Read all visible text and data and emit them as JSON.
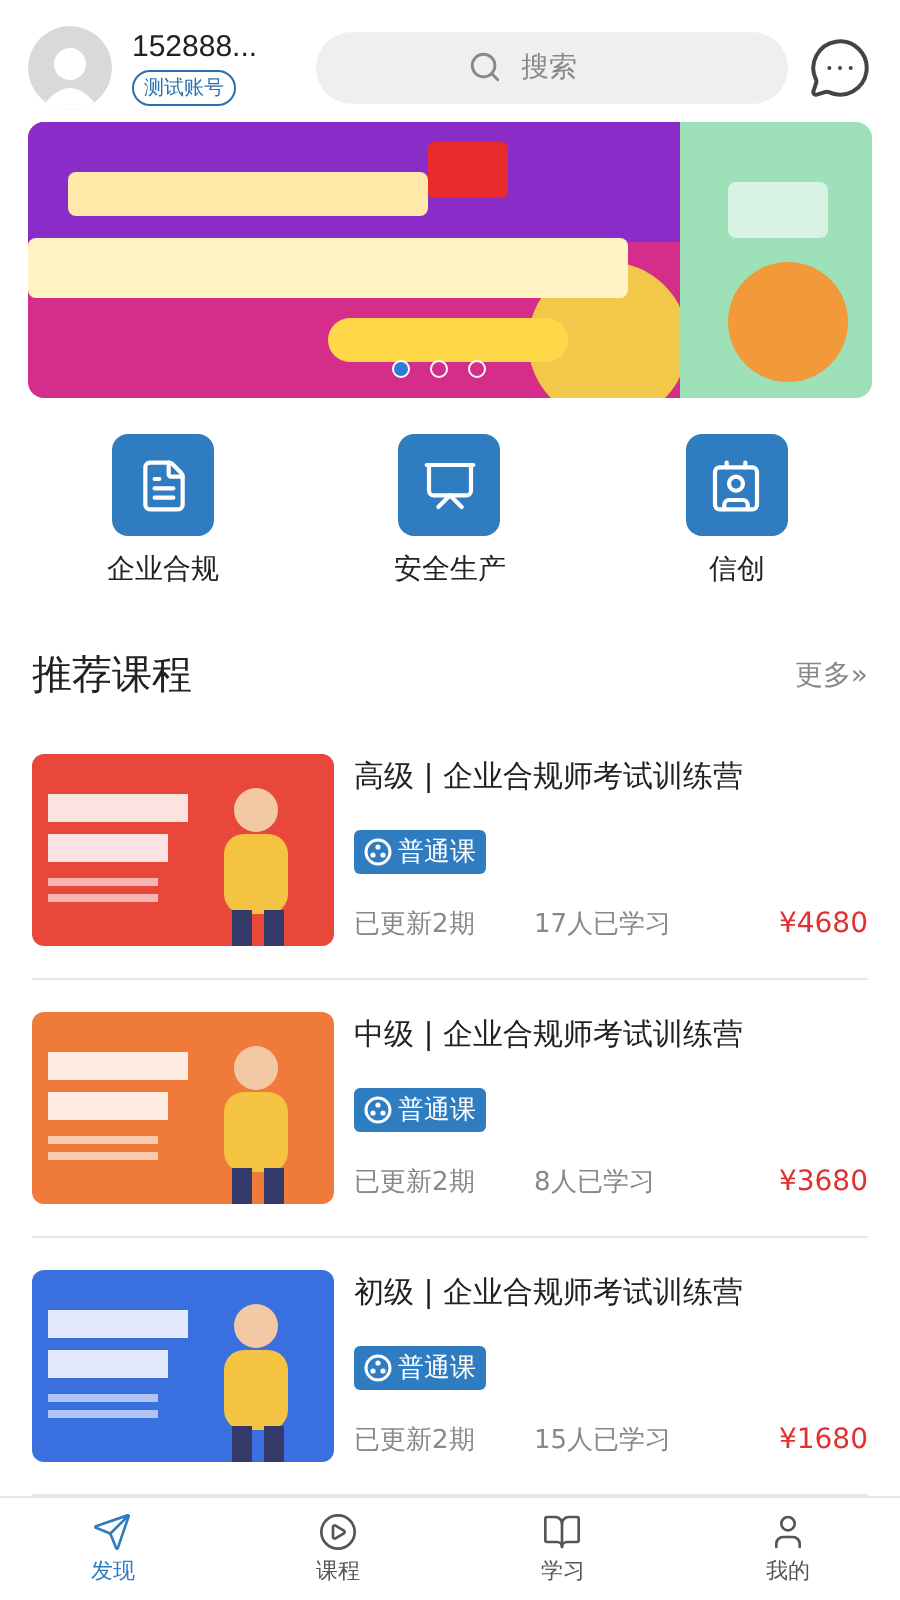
{
  "header": {
    "username": "152888...",
    "badge": "测试账号",
    "search": {
      "placeholder": "搜索"
    }
  },
  "banner": {
    "dots": [
      {
        "selected": true
      },
      {
        "selected": false
      },
      {
        "selected": false
      }
    ]
  },
  "categories": [
    {
      "label": "企业合规"
    },
    {
      "label": "安全生产"
    },
    {
      "label": "信创"
    }
  ],
  "section": {
    "title": "推荐课程",
    "more": "更多»"
  },
  "courses": [
    {
      "title": "高级 | 企业合规师考试训练营",
      "tag": "普通课",
      "updated": "已更新2期",
      "learners": "17人已学习",
      "price": "¥4680"
    },
    {
      "title": "中级 | 企业合规师考试训练营",
      "tag": "普通课",
      "updated": "已更新2期",
      "learners": "8人已学习",
      "price": "¥3680"
    },
    {
      "title": "初级 | 企业合规师考试训练营",
      "tag": "普通课",
      "updated": "已更新2期",
      "learners": "15人已学习",
      "price": "¥1680"
    }
  ],
  "tabbar": [
    {
      "label": "发现",
      "selected": true
    },
    {
      "label": "课程",
      "selected": false
    },
    {
      "label": "学习",
      "selected": false
    },
    {
      "label": "我的",
      "selected": false
    }
  ]
}
